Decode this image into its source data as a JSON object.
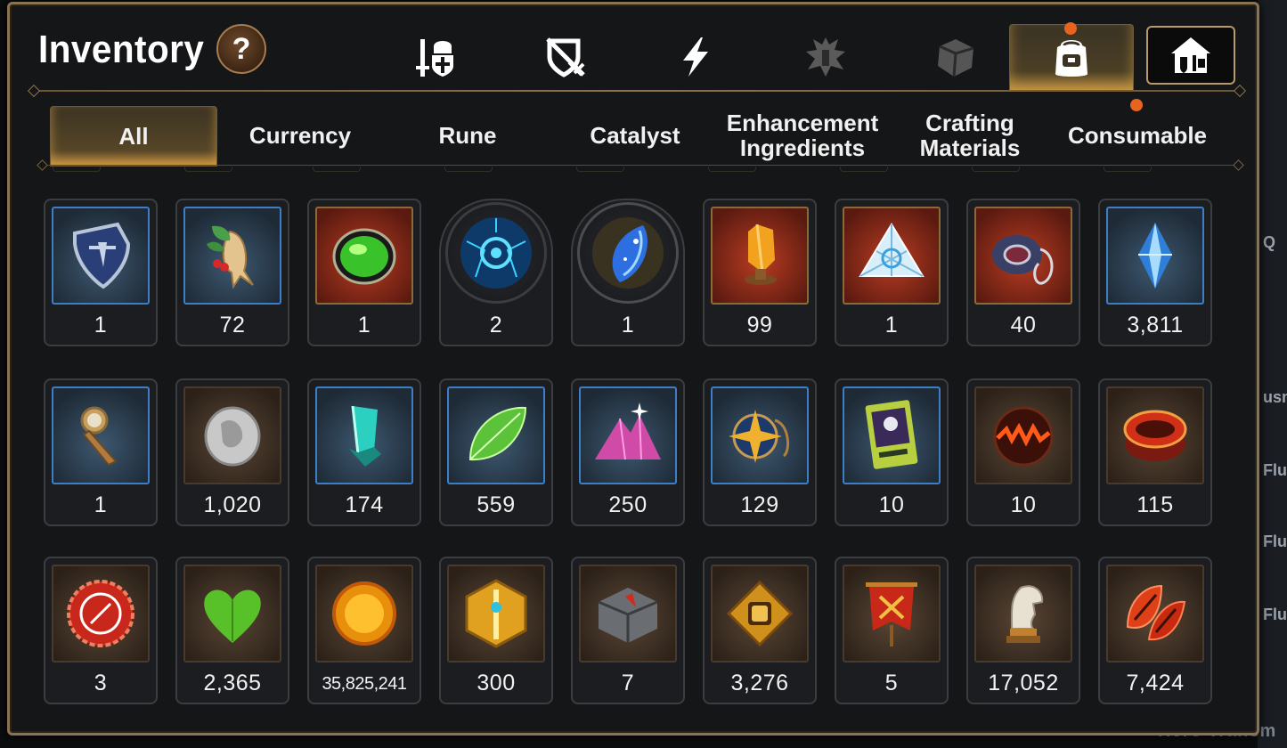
{
  "window": {
    "title": "Inventory",
    "help_label": "?"
  },
  "category_tabs": [
    {
      "name": "gear-icon",
      "active": false
    },
    {
      "name": "shield-swords-icon",
      "active": false
    },
    {
      "name": "lightning-icon",
      "active": false
    },
    {
      "name": "warrior-icon",
      "active": false
    },
    {
      "name": "cube-icon",
      "active": false
    },
    {
      "name": "backpack-icon",
      "active": true,
      "badge": true
    },
    {
      "name": "guild-house-icon",
      "active": false
    }
  ],
  "subtabs": [
    {
      "label": "All",
      "active": true
    },
    {
      "label": "Currency"
    },
    {
      "label": "Rune"
    },
    {
      "label": "Catalyst"
    },
    {
      "label": "Enhancement Ingredients",
      "line1": "Enhancement",
      "line2": "Ingredients"
    },
    {
      "label": "Crafting Materials",
      "line1": "Crafting",
      "line2": "Materials"
    },
    {
      "label": "Consumable",
      "badge": true
    }
  ],
  "items": [
    {
      "icon": "blue-shield-icon",
      "count": "1"
    },
    {
      "icon": "ginseng-root-icon",
      "count": "72"
    },
    {
      "icon": "green-orb-icon",
      "count": "1"
    },
    {
      "icon": "blue-rune-circle-icon",
      "count": "2"
    },
    {
      "icon": "galaxy-crystal-icon",
      "count": "1"
    },
    {
      "icon": "amber-crystal-icon",
      "count": "99"
    },
    {
      "icon": "triangle-crystal-icon",
      "count": "1"
    },
    {
      "icon": "ring-pendant-icon",
      "count": "40"
    },
    {
      "icon": "blue-gem-icon",
      "count": "3,811"
    },
    {
      "icon": "compass-key-icon",
      "count": "1"
    },
    {
      "icon": "silver-coin-icon",
      "count": "1,020"
    },
    {
      "icon": "teal-crystal-icon",
      "count": "174"
    },
    {
      "icon": "green-leaf-icon",
      "count": "559"
    },
    {
      "icon": "pink-crystal-pile-icon",
      "count": "250"
    },
    {
      "icon": "star-amulet-icon",
      "count": "129"
    },
    {
      "icon": "card-icon",
      "count": "10"
    },
    {
      "icon": "fire-orb-icon",
      "count": "10"
    },
    {
      "icon": "red-bracelet-icon",
      "count": "115"
    },
    {
      "icon": "red-seal-icon",
      "count": "3"
    },
    {
      "icon": "green-heart-icon",
      "count": "2,365"
    },
    {
      "icon": "gold-coin-icon",
      "count": "35,825,241"
    },
    {
      "icon": "gold-hexagon-emblem-icon",
      "count": "300"
    },
    {
      "icon": "stone-cube-icon",
      "count": "7"
    },
    {
      "icon": "fist-emblem-icon",
      "count": "3,276"
    },
    {
      "icon": "war-banner-icon",
      "count": "5"
    },
    {
      "icon": "horse-statue-icon",
      "count": "17,052"
    },
    {
      "icon": "red-leaves-icon",
      "count": "7,424"
    }
  ],
  "background": {
    "side_labels": [
      "Q",
      "usm",
      "Flu",
      "Flu",
      "Flu"
    ],
    "bottom_text": "Hero Transm"
  },
  "colors": {
    "accent": "#b99a6a",
    "badge": "#e8641e",
    "active_glow": "#a27b36"
  }
}
